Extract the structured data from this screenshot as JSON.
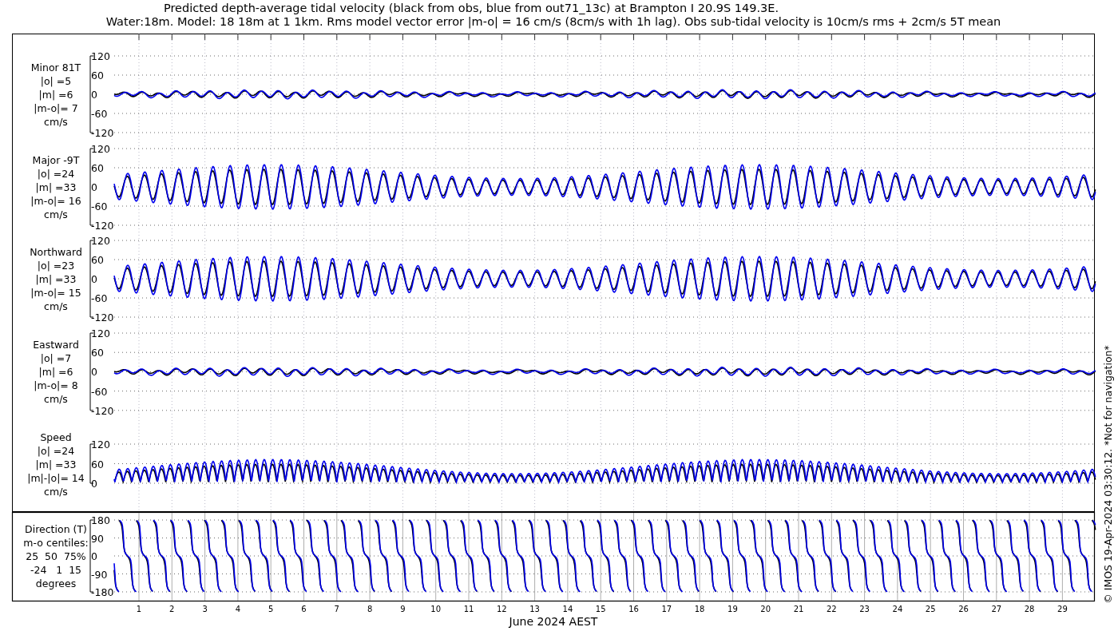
{
  "title": [
    "Predicted depth-average tidal velocity (black from obs, blue from out71_13c) at Brampton I 20.9S 149.3E.",
    "Water:18m. Model: 18 18m at 1 1km. Rms model vector error |m-o| = 16 cm/s (8cm/s with 1h lag). Obs sub-tidal velocity is 10cm/s rms + 2cm/s 5T mean"
  ],
  "panels": [
    {
      "kind": "weak",
      "label_lines": [
        "Minor 81T",
        "|o| =5",
        "|m| =6",
        "|m-o|= 7",
        "cm/s"
      ],
      "yticks": [
        "120",
        "60",
        "0",
        "-60",
        "-120"
      ]
    },
    {
      "kind": "strong",
      "label_lines": [
        "Major -9T",
        "|o| =24",
        "|m| =33",
        "|m-o|= 16",
        "cm/s"
      ],
      "yticks": [
        "120",
        "60",
        "0",
        "-60",
        "-120"
      ]
    },
    {
      "kind": "strong",
      "label_lines": [
        "Northward",
        "|o| =23",
        "|m| =33",
        "|m-o|= 15",
        "cm/s"
      ],
      "yticks": [
        "120",
        "60",
        "0",
        "-60",
        "-120"
      ]
    },
    {
      "kind": "weak",
      "label_lines": [
        "Eastward",
        "|o| =7",
        "|m| =6",
        "|m-o|= 8",
        "cm/s"
      ],
      "yticks": [
        "120",
        "60",
        "0",
        "-60",
        "-120"
      ]
    },
    {
      "kind": "speed",
      "label_lines": [
        "Speed",
        "|o| =24",
        "|m| =33",
        "|m|-|o|= 14",
        "cm/s"
      ],
      "yticks": [
        "120",
        "60",
        "0"
      ]
    },
    {
      "kind": "direction",
      "label_lines": [
        "Direction (T)",
        "m-o centiles:",
        "25  50  75%",
        "-24   1  15",
        "degrees"
      ],
      "yticks": [
        "180",
        "90",
        "0",
        "-90",
        "-180"
      ]
    }
  ],
  "xticks": [
    "1",
    "2",
    "3",
    "4",
    "5",
    "6",
    "7",
    "8",
    "9",
    "10",
    "11",
    "12",
    "13",
    "14",
    "15",
    "16",
    "17",
    "18",
    "19",
    "20",
    "21",
    "22",
    "23",
    "24",
    "25",
    "26",
    "27",
    "28",
    "29"
  ],
  "xlabel": "June 2024 AEST",
  "credit": "© IMOS 19-Apr-2024 03:30:12. *Not for navigation*"
}
